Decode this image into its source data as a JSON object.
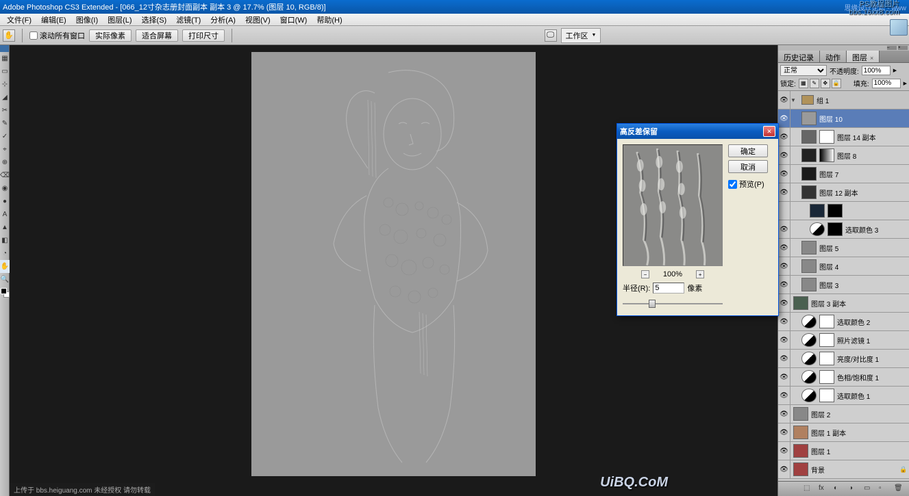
{
  "titlebar": {
    "app": "Adobe Photoshop CS3 Extended",
    "doc": "[066_12寸杂志册封面副本 副本 3 @ 17.7% (图层 10, RGB/8)]",
    "watermark_right": "思缘设计论坛 - www",
    "watermark_top": "PS教程图片\nbbs.16xx8.com"
  },
  "menu": [
    "文件(F)",
    "编辑(E)",
    "图像(I)",
    "图层(L)",
    "选择(S)",
    "滤镜(T)",
    "分析(A)",
    "视图(V)",
    "窗口(W)",
    "帮助(H)"
  ],
  "optbar": {
    "scroll_all": "滚动所有窗口",
    "btn1": "实际像素",
    "btn2": "适合屏幕",
    "btn3": "打印尺寸",
    "workspace": "工作区"
  },
  "tools": [
    "▦",
    "▭",
    "⊹",
    "◢",
    "✂",
    "✎",
    "✓",
    "⌖",
    "⊕",
    "⌫",
    "◉",
    "●",
    "A",
    "▲",
    "◧",
    "◔",
    "✋",
    "🔍"
  ],
  "dialog": {
    "title": "高反差保留",
    "ok": "确定",
    "cancel": "取消",
    "preview": "预览(P)",
    "zoom": "100%",
    "radius_label": "半径(R):",
    "radius_value": "5",
    "radius_unit": "像素"
  },
  "panels": {
    "tabs": [
      "历史记录",
      "动作",
      "图层"
    ],
    "active_tab": 2,
    "blend_mode": "正常",
    "opacity_label": "不透明度:",
    "opacity": "100%",
    "lock_label": "锁定:",
    "fill_label": "填充:",
    "fill": "100%"
  },
  "layers": [
    {
      "type": "group",
      "name": "组 1",
      "indent": 0,
      "vis": true,
      "expanded": true
    },
    {
      "type": "normal",
      "name": "图层 10",
      "indent": 1,
      "vis": true,
      "selected": true,
      "thumb": "#9a9a9a"
    },
    {
      "type": "masked",
      "name": "图层 14 副本",
      "indent": 1,
      "vis": true,
      "thumb": "#666",
      "mask": "white"
    },
    {
      "type": "masked",
      "name": "图层 8",
      "indent": 1,
      "vis": true,
      "thumb": "#222",
      "mask": "gradient"
    },
    {
      "type": "normal",
      "name": "图层 7",
      "indent": 1,
      "vis": true,
      "thumb": "#1a1a1a"
    },
    {
      "type": "normal",
      "name": "图层 12 副本",
      "indent": 1,
      "vis": true,
      "thumb": "#333"
    },
    {
      "type": "doublemask",
      "name": "",
      "indent": 2,
      "vis": false,
      "thumb": "#1a2838",
      "mask": "black"
    },
    {
      "type": "adjustment",
      "name": "选取颜色 3",
      "indent": 2,
      "vis": true,
      "mask": "black"
    },
    {
      "type": "normal",
      "name": "图层 5",
      "indent": 1,
      "vis": true,
      "thumb": "checkers"
    },
    {
      "type": "normal",
      "name": "图层 4",
      "indent": 1,
      "vis": true,
      "thumb": "checkers"
    },
    {
      "type": "normal",
      "name": "图层 3",
      "indent": 1,
      "vis": true,
      "thumb": "checkers"
    },
    {
      "type": "normal",
      "name": "图层 3 副本",
      "indent": 0,
      "vis": true,
      "thumb": "#4a6050"
    },
    {
      "type": "adjustment",
      "name": "选取颜色 2",
      "indent": 1,
      "vis": true,
      "mask": "white"
    },
    {
      "type": "adjustment",
      "name": "照片滤镜 1",
      "indent": 1,
      "vis": true,
      "mask": "white"
    },
    {
      "type": "adjustment",
      "name": "亮度/对比度 1",
      "indent": 1,
      "vis": true,
      "mask": "white"
    },
    {
      "type": "adjustment",
      "name": "色相/饱和度 1",
      "indent": 1,
      "vis": true,
      "mask": "white"
    },
    {
      "type": "adjustment",
      "name": "选取颜色 1",
      "indent": 1,
      "vis": true,
      "mask": "white"
    },
    {
      "type": "normal",
      "name": "图层 2",
      "indent": 0,
      "vis": true,
      "thumb": "checkers"
    },
    {
      "type": "normal",
      "name": "图层 1 副本",
      "indent": 0,
      "vis": true,
      "thumb": "#b08060"
    },
    {
      "type": "normal",
      "name": "图层 1",
      "indent": 0,
      "vis": true,
      "thumb": "#a04040"
    },
    {
      "type": "background",
      "name": "背景",
      "indent": 0,
      "vis": true,
      "thumb": "#a04040",
      "locked": true
    }
  ],
  "footer": "上传于 bbs.heiguang.com  未经授权  请勿转载",
  "logo": "UiBQ.CoM"
}
